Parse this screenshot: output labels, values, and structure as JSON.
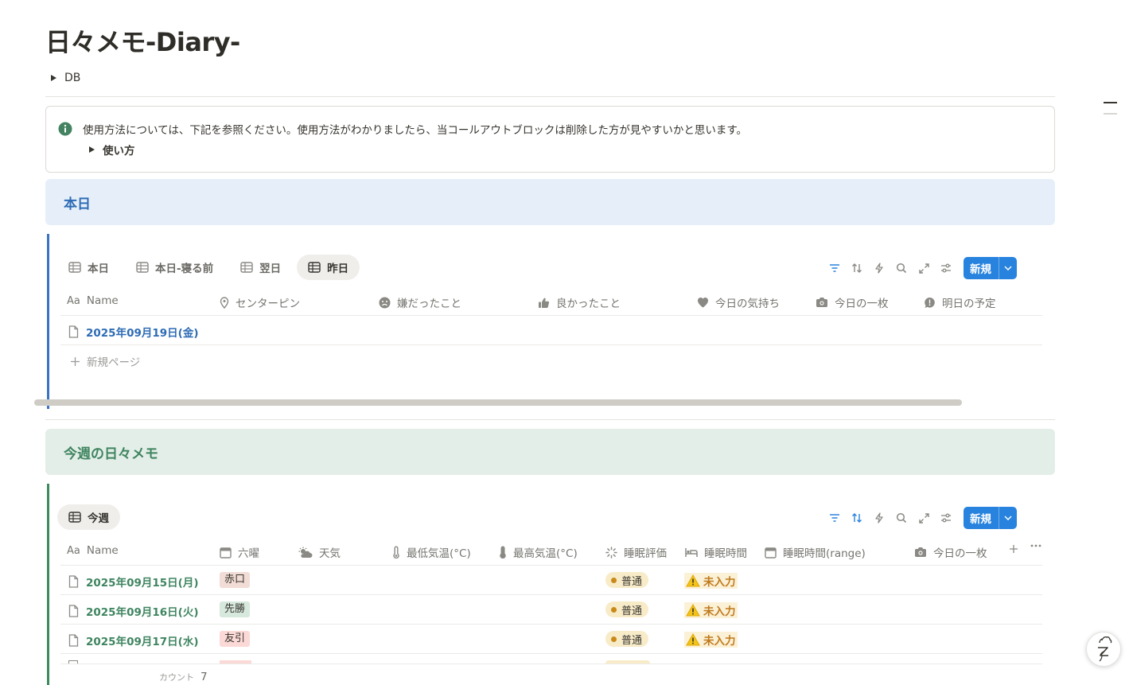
{
  "page": {
    "title": "日々メモ-Diary-",
    "db_toggle_label": "DB"
  },
  "callout": {
    "text": "使用方法については、下記を参照ください。使用方法がわかりましたら、当コールアウトブロックは削除した方が見やすいかと思います。",
    "toggle_label": "使い方"
  },
  "today_section": {
    "heading": "本日",
    "views": [
      "本日",
      "本日-寝る前",
      "翌日",
      "昨日"
    ],
    "active_view": "昨日",
    "new_button": "新規",
    "columns": [
      "Name",
      "センターピン",
      "嫌だったこと",
      "良かったこと",
      "今日の気持ち",
      "今日の一枚",
      "明日の予定"
    ],
    "rows": [
      {
        "name": "2025年09月19日(金)"
      }
    ],
    "new_page_label": "新規ページ"
  },
  "week_section": {
    "heading": "今週の日々メモ",
    "views": [
      "今週"
    ],
    "active_view": "今週",
    "new_button": "新規",
    "columns": [
      "Name",
      "六曜",
      "天気",
      "最低気温(°C)",
      "最高気温(°C)",
      "睡眠評価",
      "睡眠時間",
      "睡眠時間(range)",
      "今日の一枚"
    ],
    "rows": [
      {
        "name": "2025年09月15日(月)",
        "rokuyo": "赤口",
        "sleep_rating": "普通",
        "sleep_time": "未入力"
      },
      {
        "name": "2025年09月16日(火)",
        "rokuyo": "先勝",
        "sleep_rating": "普通",
        "sleep_time": "未入力"
      },
      {
        "name": "2025年09月17日(水)",
        "rokuyo": "友引",
        "sleep_rating": "普通",
        "sleep_time": "未入力"
      }
    ],
    "count_label": "カウント",
    "count_value": "7"
  },
  "colors": {
    "blue_accent": "#3a73c4",
    "green_accent": "#3d8a5d",
    "new_button": "#2783de",
    "tag_shakko": "#f2dcd6",
    "tag_sensho": "#d7e8dd",
    "tag_tomobiki": "#fbd9d6",
    "sleep_pill": "#f8ebc8"
  },
  "icons": {
    "callout": "info-icon",
    "help": "help-assistant-icon"
  }
}
